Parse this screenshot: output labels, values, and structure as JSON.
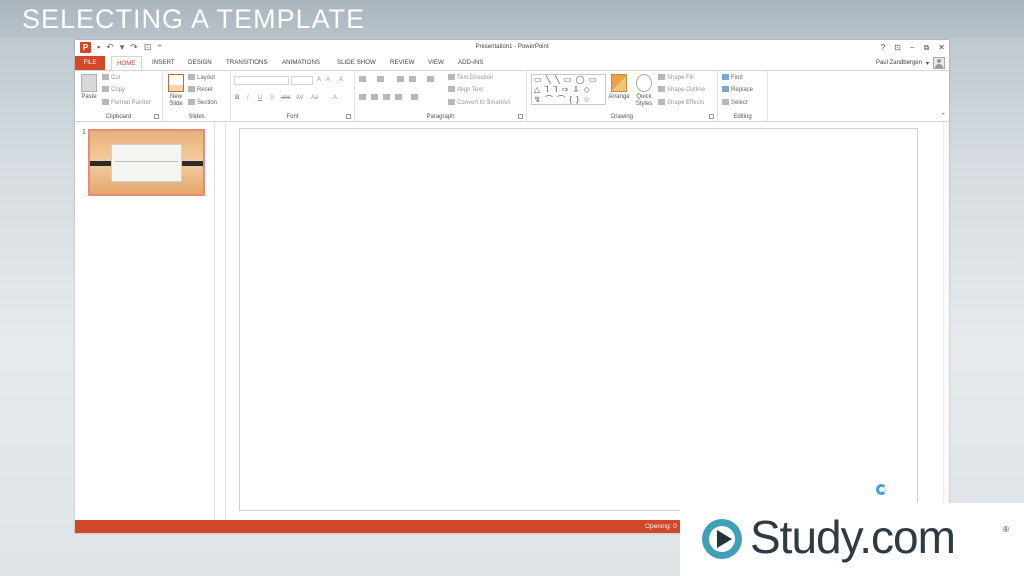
{
  "video": {
    "title": "SELECTING A TEMPLATE"
  },
  "window": {
    "title": "Presentation1 - PowerPoint",
    "logo_letter": "P",
    "controls": [
      "?",
      "⊡",
      "−",
      "⧉",
      "✕"
    ]
  },
  "qat": {
    "save_icon": "▪",
    "undo_icon": "↶",
    "undo_arrow": "▾",
    "redo_icon": "↷",
    "present_icon": "⊡",
    "customize_icon": "⁼"
  },
  "tabs": [
    "FILE",
    "HOME",
    "INSERT",
    "DESIGN",
    "TRANSITIONS",
    "ANIMATIONS",
    "SLIDE SHOW",
    "REVIEW",
    "VIEW",
    "ADD-INS"
  ],
  "user": {
    "name": "Paul Zandbergen",
    "caret": "▾"
  },
  "ribbon": {
    "clipboard": {
      "label": "Clipboard",
      "paste": "Paste",
      "cut": "Cut",
      "copy": "Copy",
      "format_painter": "Format Painter"
    },
    "slides": {
      "label": "Slides",
      "new_slide_line1": "New",
      "new_slide_line2": "Slide",
      "layout": "Layout",
      "reset": "Reset",
      "section": "Section"
    },
    "font": {
      "label": "Font",
      "bold": "B",
      "italic": "I",
      "underline": "U",
      "shadow": "S",
      "strike": "abc",
      "spacing": "AV",
      "case": "Aa",
      "grow": "A",
      "shrink": "A",
      "clear": "A",
      "color": "A"
    },
    "paragraph": {
      "label": "Paragraph",
      "text_direction": "Text Direction",
      "align_text": "Align Text",
      "convert_smartart": "Convert to SmartArt"
    },
    "drawing": {
      "label": "Drawing",
      "shapes_row1": "▭ ╲ ╲ ▭ ◯ ▭",
      "shapes_row2": "△ ⅂ ⅂ ⇨ ⇩ ◇",
      "shapes_row3": "↯ ⌒ ⌒ { } ☆",
      "arrange": "Arrange",
      "quick_styles_line1": "Quick",
      "quick_styles_line2": "Styles",
      "shape_fill": "Shape Fill",
      "shape_outline": "Shape Outline",
      "shape_effects": "Shape Effects"
    },
    "editing": {
      "label": "Editing",
      "find": "Find",
      "replace": "Replace",
      "select": "Select"
    },
    "collapse": "⌃"
  },
  "thumbnails": [
    {
      "number": "1"
    }
  ],
  "status": {
    "text": "Opening: 0"
  },
  "logo": {
    "text": "Study.com",
    "registered": "®"
  },
  "colors": {
    "accent": "#d24726",
    "banner": "#a9b4bd",
    "busy_ring": "#4aa3d8",
    "logo_teal": "#3fa0b6"
  }
}
